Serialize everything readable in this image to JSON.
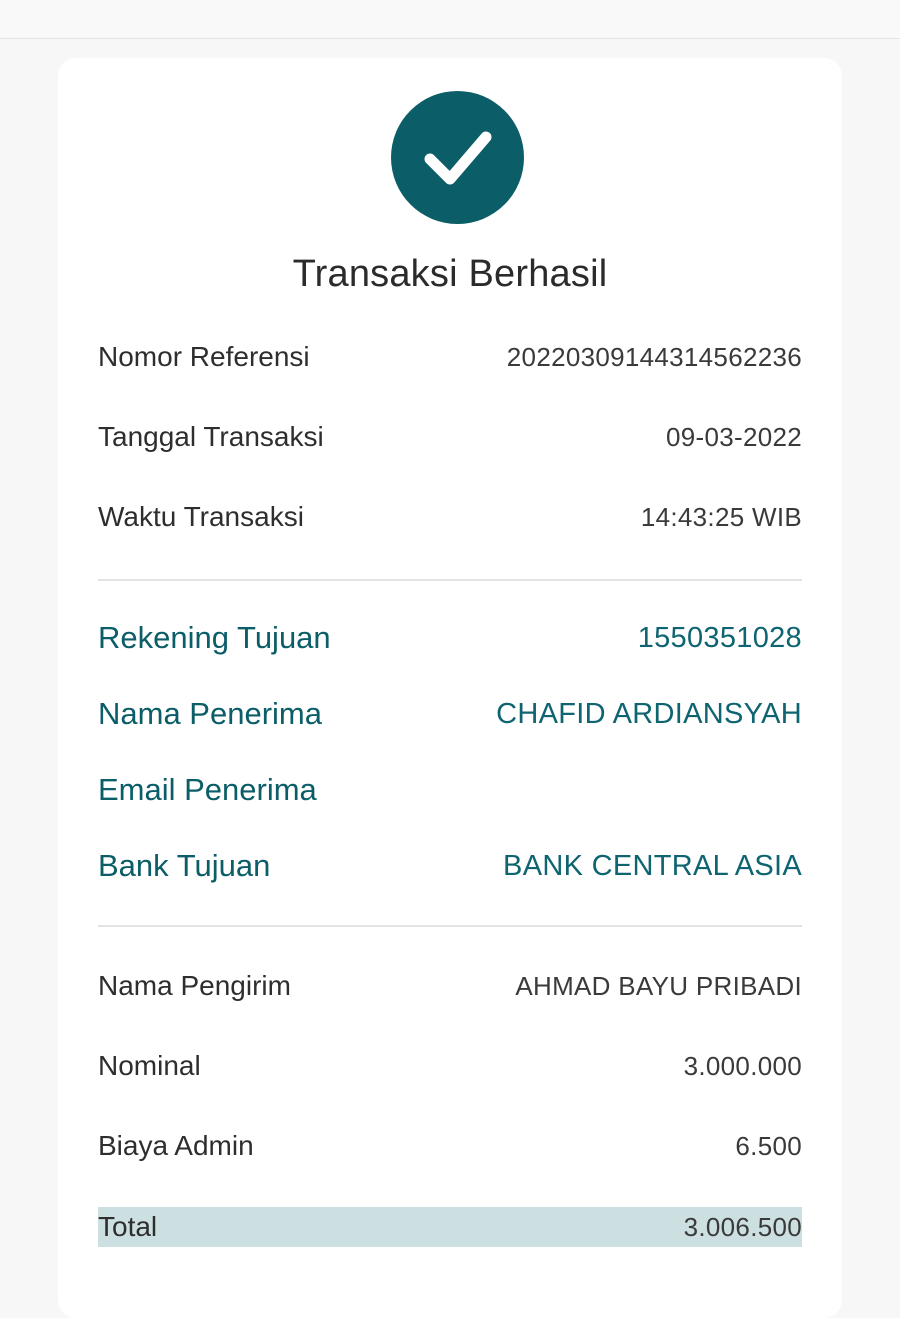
{
  "header": {
    "title": "Transaksi Berhasil",
    "status_icon": "check-icon",
    "accent_color": "#0b5d67"
  },
  "transaction_info": {
    "reference_label": "Nomor Referensi",
    "reference_value": "20220309144314562236",
    "date_label": "Tanggal Transaksi",
    "date_value": "09-03-2022",
    "time_label": "Waktu Transaksi",
    "time_value": "14:43:25 WIB"
  },
  "recipient": {
    "account_label": "Rekening Tujuan",
    "account_value": "1550351028",
    "name_label": "Nama Penerima",
    "name_value": "CHAFID ARDIANSYAH",
    "email_label": "Email Penerima",
    "email_value": "",
    "bank_label": "Bank Tujuan",
    "bank_value": "BANK CENTRAL ASIA"
  },
  "payment": {
    "sender_label": "Nama Pengirim",
    "sender_value": "AHMAD BAYU PRIBADI",
    "nominal_label": "Nominal",
    "nominal_value": "3.000.000",
    "fee_label": "Biaya Admin",
    "fee_value": "6.500",
    "total_label": "Total",
    "total_value": "3.006.500",
    "total_highlight_color": "#cde0e1"
  }
}
